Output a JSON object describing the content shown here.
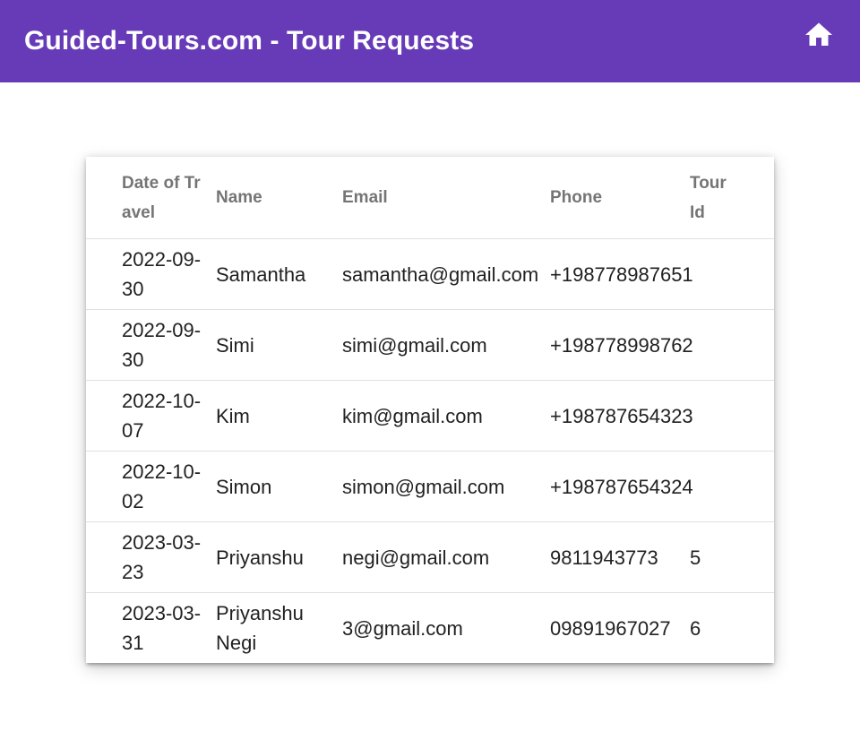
{
  "header": {
    "title": "Guided-Tours.com - Tour Requests",
    "home_icon": "home-icon"
  },
  "colors": {
    "toolbar": "#673ab7",
    "header_text": "#757575",
    "cell_text": "#212121"
  },
  "table": {
    "columns": [
      "Date of Travel",
      "Name",
      "Email",
      "Phone",
      "Tour Id"
    ],
    "rows": [
      {
        "date": "2022-09-30",
        "name": "Samantha",
        "email": "samantha@gmail.com",
        "phone": "+198778987651",
        "tour_id": ""
      },
      {
        "date": "2022-09-30",
        "name": "Simi",
        "email": "simi@gmail.com",
        "phone": "+198778998762",
        "tour_id": ""
      },
      {
        "date": "2022-10-07",
        "name": "Kim",
        "email": "kim@gmail.com",
        "phone": "+198787654323",
        "tour_id": ""
      },
      {
        "date": "2022-10-02",
        "name": "Simon",
        "email": "simon@gmail.com",
        "phone": "+198787654324",
        "tour_id": ""
      },
      {
        "date": "2023-03-23",
        "name": "Priyanshu",
        "email": "negi@gmail.com",
        "phone": "9811943773",
        "tour_id": "5"
      },
      {
        "date": "2023-03-31",
        "name": "Priyanshu Negi",
        "email": "3@gmail.com",
        "phone": "09891967027",
        "tour_id": "6"
      }
    ]
  }
}
